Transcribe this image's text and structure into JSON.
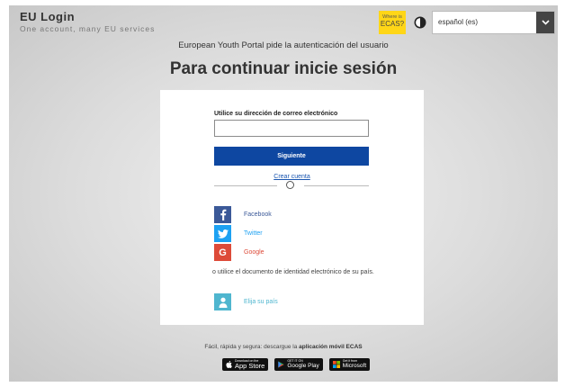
{
  "brand": {
    "title": "EU Login",
    "subtitle": "One account, many EU services"
  },
  "ecas_badge": {
    "line1": "Where is",
    "line2": "ECAS?"
  },
  "language": {
    "selected": "español (es)"
  },
  "auth_message": "European Youth Portal pide la autenticación del usuario",
  "heading": "Para continuar inicie sesión",
  "form": {
    "email_label": "Utilice su dirección de correo electrónico",
    "email_value": "",
    "next_button": "Siguiente",
    "create_account": "Crear cuenta"
  },
  "social": [
    {
      "label": "Facebook",
      "icon": "facebook-icon",
      "color": "#3b5998"
    },
    {
      "label": "Twitter",
      "icon": "twitter-icon",
      "color": "#1da1f2"
    },
    {
      "label": "Google",
      "icon": "google-icon",
      "color": "#dd4b39"
    }
  ],
  "eid": {
    "text": "o utilice el documento de identidad electrónico de su país.",
    "choose_country": "Elija su país",
    "color": "#4fb6cf"
  },
  "footer": {
    "text_before": "Fácil, rápida y segura: descargue la ",
    "text_bold": "aplicación móvil ECAS",
    "appstore_small": "Download on the",
    "appstore": "App Store",
    "googleplay_small": "GET IT ON",
    "googleplay": "Google Play",
    "microsoft_small": "Get it from",
    "microsoft": "Microsoft"
  },
  "colors": {
    "primary": "#0e47a1",
    "link": "#1a56b0",
    "ecas_yellow": "#ffd617"
  }
}
